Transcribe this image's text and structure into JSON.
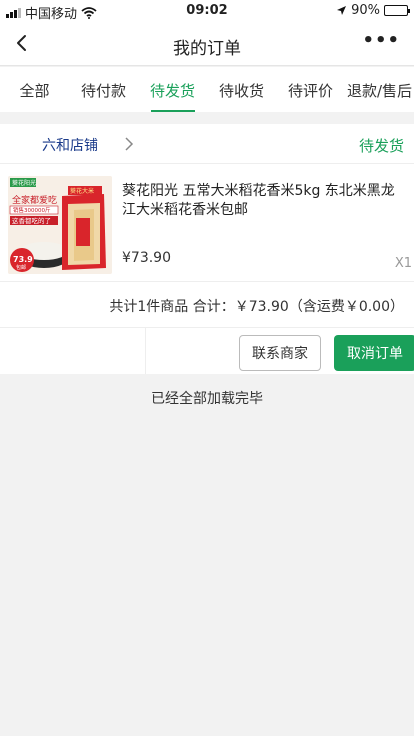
{
  "status_bar": {
    "carrier": "中国移动",
    "time": "09:02",
    "battery_percent": "90%",
    "battery_level": 0.9,
    "icons": [
      "signal-icon",
      "wifi-icon",
      "location-arrow-icon",
      "battery-icon"
    ]
  },
  "nav": {
    "title": "我的订单",
    "back_icon": "chevron-left-icon",
    "more_label": "•••"
  },
  "tabs": [
    {
      "label": "全部",
      "active": false
    },
    {
      "label": "待付款",
      "active": false
    },
    {
      "label": "待发货",
      "active": true
    },
    {
      "label": "待收货",
      "active": false
    },
    {
      "label": "待评价",
      "active": false
    },
    {
      "label": "退款/售后",
      "active": false
    }
  ],
  "order": {
    "shop_name": "六和店铺",
    "status": "待发货",
    "product": {
      "name": "葵花阳光 五常大米稻花香米5kg 东北米黑龙江大米稻花香米包邮",
      "price": "¥73.90",
      "quantity": "X1",
      "image_text": {
        "brand": "葵花阳光",
        "banner": "全家都爱吃",
        "badge": "销售300000斤",
        "slogan": "这香都吃的了",
        "price_tag": "73.9",
        "price_tag_sub": "包邮"
      }
    },
    "summary": "共计1件商品 合计：￥73.90（含运费￥0.00）",
    "buttons": {
      "contact": "联系商家",
      "cancel": "取消订单"
    }
  },
  "list_end_text": "已经全部加载完毕",
  "colors": {
    "accent_green": "#1aa05a",
    "shop_blue": "#1a3a8a",
    "price_red": "#e02020"
  }
}
